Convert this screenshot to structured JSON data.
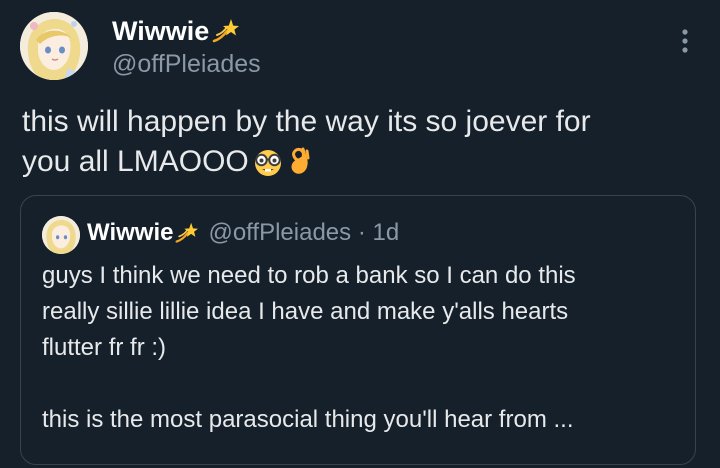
{
  "author": {
    "display_name": "Wiwwie",
    "name_emoji": "dizzy-sparkle-icon",
    "handle": "@offPleiades"
  },
  "menu": {
    "icon": "more-vertical-icon"
  },
  "tweet": {
    "lines": [
      "this will happen by the way its so joever for",
      "you all LMAOOO"
    ],
    "emojis": [
      "nerd-face-icon",
      "ok-hand-icon"
    ]
  },
  "quote": {
    "display_name": "Wiwwie",
    "handle": "@offPleiades",
    "separator": "·",
    "time": "1d",
    "lines": [
      "guys I think we need to rob a bank so I can do this",
      "really sillie lillie idea I have and make y'alls hearts",
      "flutter fr fr :)",
      "",
      "this is the most parasocial thing you'll hear from ..."
    ]
  },
  "colors": {
    "background": "#15202b",
    "primary_text": "#e7e9ea",
    "secondary_text": "#8b98a5",
    "border": "#38444d"
  }
}
